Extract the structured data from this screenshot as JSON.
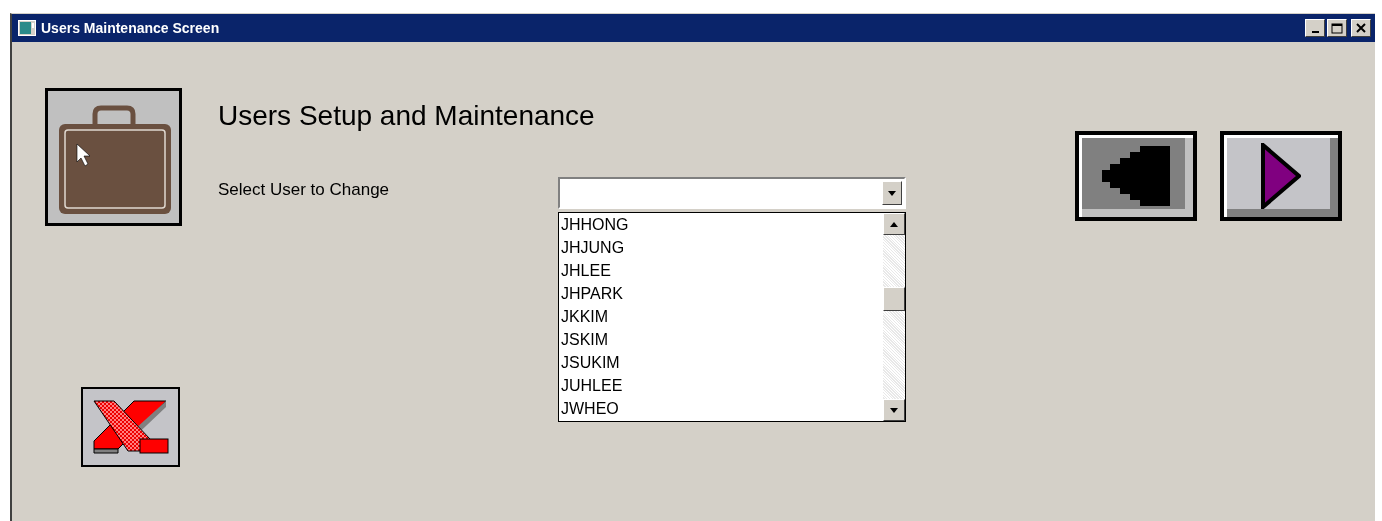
{
  "window": {
    "title": "Users Maintenance Screen"
  },
  "heading": "Users Setup and Maintenance",
  "user_select": {
    "label": "Select User to Change",
    "options": [
      {
        "label": "JHHONG",
        "selected": false
      },
      {
        "label": "JHJUNG",
        "selected": false
      },
      {
        "label": "JHLEE",
        "selected": false
      },
      {
        "label": "JHPARK",
        "selected": false
      },
      {
        "label": "JKKIM",
        "selected": false
      },
      {
        "label": "JSKIM",
        "selected": false
      },
      {
        "label": "JSUKIM",
        "selected": false
      },
      {
        "label": "JUHLEE",
        "selected": false
      },
      {
        "label": "JWHEO",
        "selected": false
      }
    ]
  }
}
